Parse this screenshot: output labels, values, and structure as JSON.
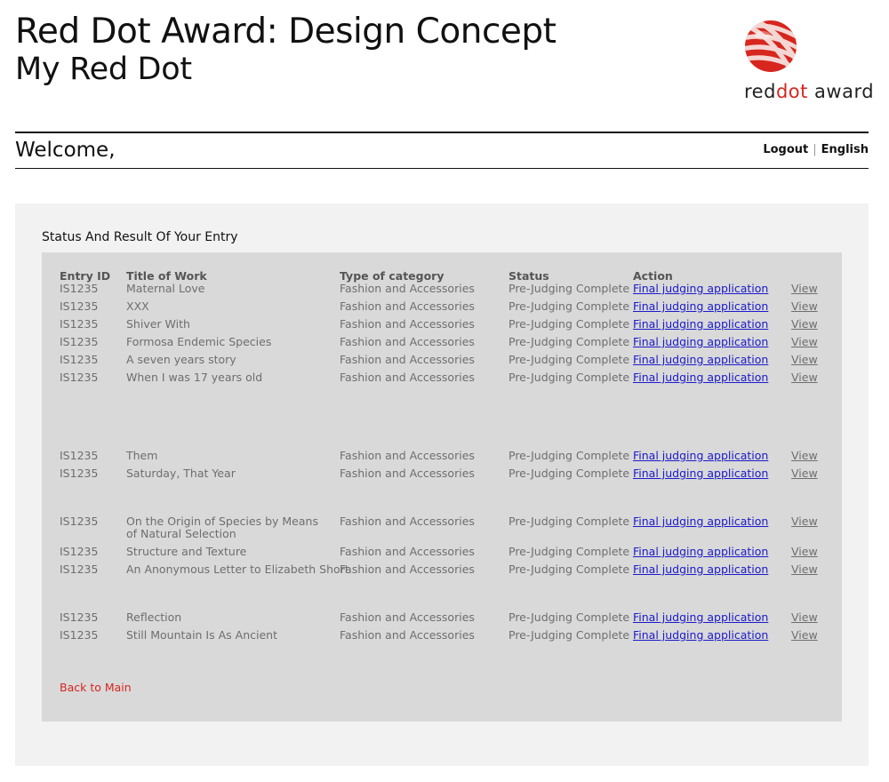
{
  "header": {
    "title": "Red Dot Award: Design Concept",
    "subtitle": "My Red Dot",
    "logo_text_part1": "red",
    "logo_text_part2": "dot",
    "logo_text_part3": " award"
  },
  "user_bar": {
    "welcome": "Welcome,",
    "logout": "Logout",
    "language": "English",
    "separator": "|"
  },
  "section": {
    "title": "Status And Result Of Your Entry"
  },
  "table": {
    "headers": [
      "Entry ID",
      "Title of Work",
      "Type of category",
      "Status",
      "Action"
    ],
    "rows": [
      {
        "id": "IS1235",
        "title": "Maternal Love",
        "type": "Fashion and Accessories",
        "status": "Pre-Judging Complete",
        "action": "Final judging application",
        "view": "View"
      },
      {
        "id": "IS1235",
        "title": "XXX",
        "type": "Fashion and Accessories",
        "status": "Pre-Judging Complete",
        "action": "Final judging application",
        "view": "View"
      },
      {
        "id": "IS1235",
        "title": "Shiver With",
        "type": "Fashion and Accessories",
        "status": "Pre-Judging Complete",
        "action": "Final judging application",
        "view": "View"
      },
      {
        "id": "IS1235",
        "title": "Formosa Endemic Species",
        "type": "Fashion and Accessories",
        "status": "Pre-Judging Complete",
        "action": "Final judging application",
        "view": "View"
      },
      {
        "id": "IS1235",
        "title": "A seven years story",
        "type": "Fashion and Accessories",
        "status": "Pre-Judging Complete",
        "action": "Final judging application",
        "view": "View"
      },
      {
        "id": "IS1235",
        "title": "When I was 17 years old",
        "type": "Fashion and Accessories",
        "status": "Pre-Judging Complete",
        "action": "Final judging application",
        "view": "View"
      },
      {
        "id": "IS1235",
        "title": "Them",
        "type": "Fashion and Accessories",
        "status": "Pre-Judging Complete",
        "action": "Final judging application",
        "view": "View"
      },
      {
        "id": "IS1235",
        "title": "Saturday, That Year",
        "type": "Fashion and Accessories",
        "status": "Pre-Judging Complete",
        "action": "Final judging application",
        "view": "View"
      },
      {
        "id": "IS1235",
        "title": "On the Origin of Species by Means of Natural Selection",
        "type": "Fashion and Accessories",
        "status": "Pre-Judging Complete",
        "action": "Final judging application",
        "view": "View"
      },
      {
        "id": "IS1235",
        "title": "Structure and Texture",
        "type": "Fashion and Accessories",
        "status": "Pre-Judging Complete",
        "action": "Final judging application",
        "view": "View"
      },
      {
        "id": "IS1235",
        "title": "An Anonymous Letter to Elizabeth Short",
        "type": "Fashion and Accessories",
        "status": "Pre-Judging Complete",
        "action": "Final judging application",
        "view": "View"
      },
      {
        "id": "IS1235",
        "title": "Reflection",
        "type": "Fashion and Accessories",
        "status": "Pre-Judging Complete",
        "action": "Final judging application",
        "view": "View"
      },
      {
        "id": "IS1235",
        "title": "Still Mountain Is As Ancient",
        "type": "Fashion and Accessories",
        "status": "Pre-Judging Complete",
        "action": "Final judging application",
        "view": "View"
      }
    ]
  },
  "footer": {
    "back": "Back to Main"
  },
  "colors": {
    "brand_red": "#d7261e",
    "link_blue": "#1a1acc",
    "panel_outer": "#f2f2f2",
    "panel_inner": "#d9d9d9"
  }
}
